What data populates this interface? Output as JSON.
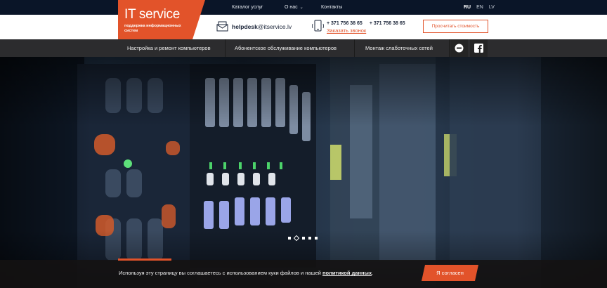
{
  "topnav": {
    "items": [
      "Каталог услуг",
      "О нас",
      "Контакты"
    ],
    "chevron": "chevron-down-icon"
  },
  "languages": [
    "RU",
    "EN",
    "LV"
  ],
  "logo": {
    "title": "IT service",
    "subtitle": "поддержка информационных систем"
  },
  "contact": {
    "email_user": "helpdesk",
    "email_domain": "@itservice.lv",
    "phones": [
      "+ 371 756 38 65",
      "+ 371 756 38 65"
    ],
    "callback_link": "Заказать звонок"
  },
  "calc_button": "Просчитать стоимость",
  "mainnav": {
    "items": [
      "Настройка и ремонт компьютеров",
      "Абонентское обслуживание компьютеров",
      "Монтаж слаботочных сетей"
    ]
  },
  "slider": {
    "total_slides": 5,
    "active_index": 1
  },
  "cookie": {
    "text": "Используя эту страницу вы соглашаетесь с использованием куки файлов и нашей ",
    "link": "политикой данных",
    "text_end": ".",
    "button": "Я согласен"
  },
  "colors": {
    "accent": "#e2532a",
    "topbar": "#0a1528",
    "nav": "#2c2c2e"
  }
}
